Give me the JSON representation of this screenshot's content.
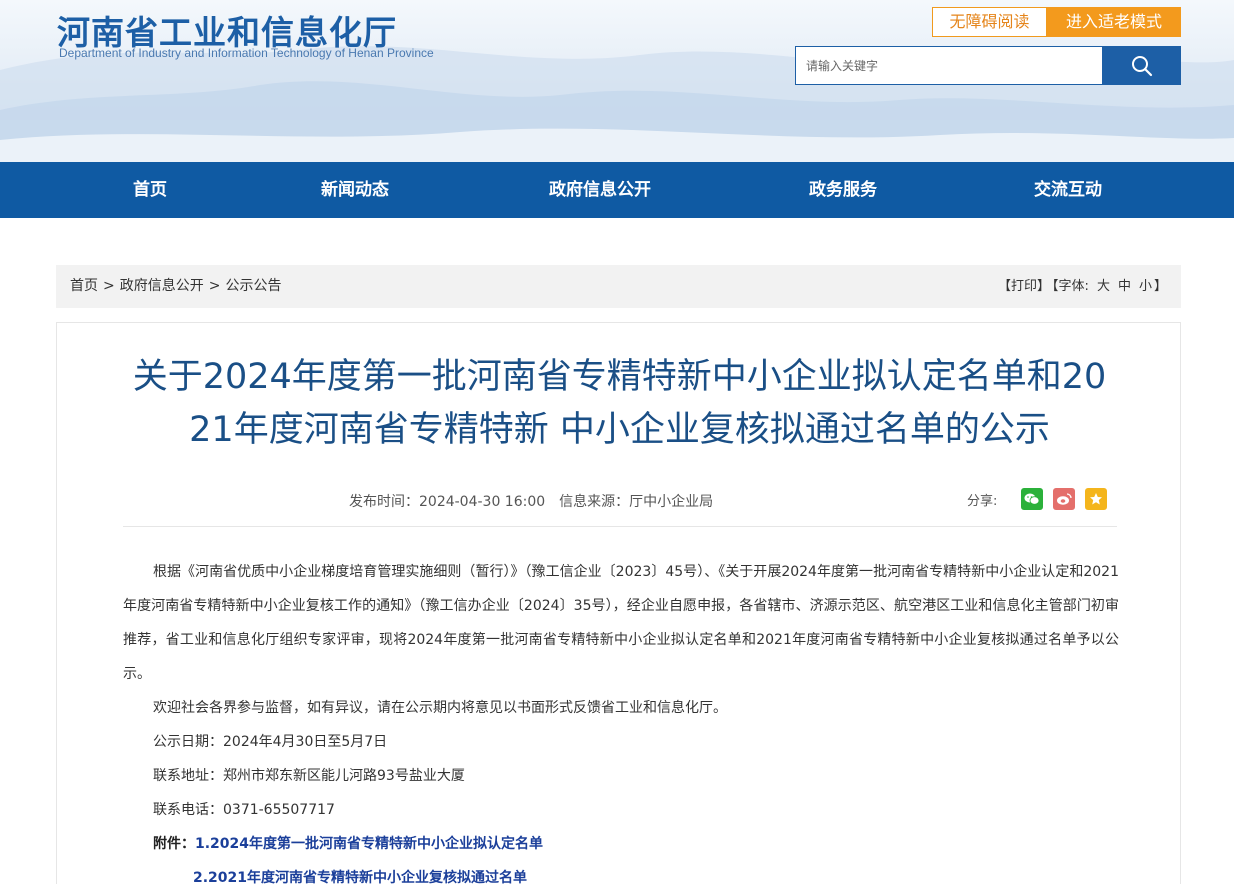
{
  "header": {
    "site_title": "河南省工业和信息化厅",
    "site_subtitle": "Department of Industry and Information Technology of Henan Province",
    "accessibility_label": "无障碍阅读",
    "elder_mode_label": "进入适老模式",
    "search_placeholder": "请输入关键字"
  },
  "nav": {
    "items": [
      {
        "label": "首页"
      },
      {
        "label": "新闻动态"
      },
      {
        "label": "政府信息公开"
      },
      {
        "label": "政务服务"
      },
      {
        "label": "交流互动"
      }
    ]
  },
  "breadcrumb": {
    "items": [
      "首页",
      "政府信息公开",
      "公示公告"
    ],
    "separator": ">"
  },
  "tools": {
    "print": "【打印】",
    "font_label": "【字体:",
    "large": "大",
    "medium": "中",
    "small": "小",
    "close": "】"
  },
  "article": {
    "title_line1": "关于2024年度第一批河南省专精特新中小企业拟认定名单和20",
    "title_line2": "21年度河南省专精特新 中小企业复核拟通过名单的公示",
    "publish_time": "发布时间：2024-04-30 16:00",
    "source": "信息来源：厅中小企业局",
    "share_label": "分享:",
    "paragraph1": "根据《河南省优质中小企业梯度培育管理实施细则（暂行）》（豫工信企业〔2023〕45号）、《关于开展2024年度第一批河南省专精特新中小企业认定和2021年度河南省专精特新中小企业复核工作的通知》（豫工信办企业〔2024〕35号），经企业自愿申报，各省辖市、济源示范区、航空港区工业和信息化主管部门初审推荐，省工业和信息化厅组织专家评审，现将2024年度第一批河南省专精特新中小企业拟认定名单和2021年度河南省专精特新中小企业复核拟通过名单予以公示。",
    "paragraph2": "欢迎社会各界参与监督，如有异议，请在公示期内将意见以书面形式反馈省工业和信息化厅。",
    "notice_period": "公示日期：2024年4月30日至5月7日",
    "address": "联系地址：郑州市郑东新区能儿河路93号盐业大厦",
    "phone": "联系电话：0371-65507717",
    "attachment_label": "附件：",
    "attachment1": "1.2024年度第一批河南省专精特新中小企业拟认定名单",
    "attachment2": "2.2021年度河南省专精特新中小企业复核拟通过名单"
  },
  "icons": {
    "search": "search-icon",
    "share_wechat": "wechat-icon",
    "share_weibo": "weibo-icon",
    "share_qzone": "qzone-icon"
  },
  "colors": {
    "brand_blue": "#0f5aa3",
    "title_blue": "#1a4f86",
    "accent_orange": "#f39a1d",
    "link_blue": "#1b3f9a"
  }
}
